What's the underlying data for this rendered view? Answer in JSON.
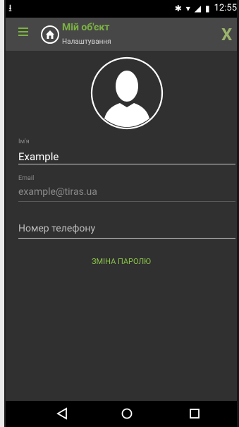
{
  "status_bar": {
    "time": "12:55"
  },
  "app_bar": {
    "title": "Мій об'єкт",
    "subtitle": "Налаштування"
  },
  "form": {
    "name": {
      "label": "Ім'я",
      "value": "Example"
    },
    "email": {
      "label": "Email",
      "value": "example@tiras.ua"
    },
    "phone": {
      "placeholder": "Номер телефону"
    }
  },
  "change_password_label": "ЗМІНА ПАРОЛЮ",
  "colors": {
    "accent": "#7cb342",
    "background": "#303030",
    "appbar": "#474747"
  }
}
